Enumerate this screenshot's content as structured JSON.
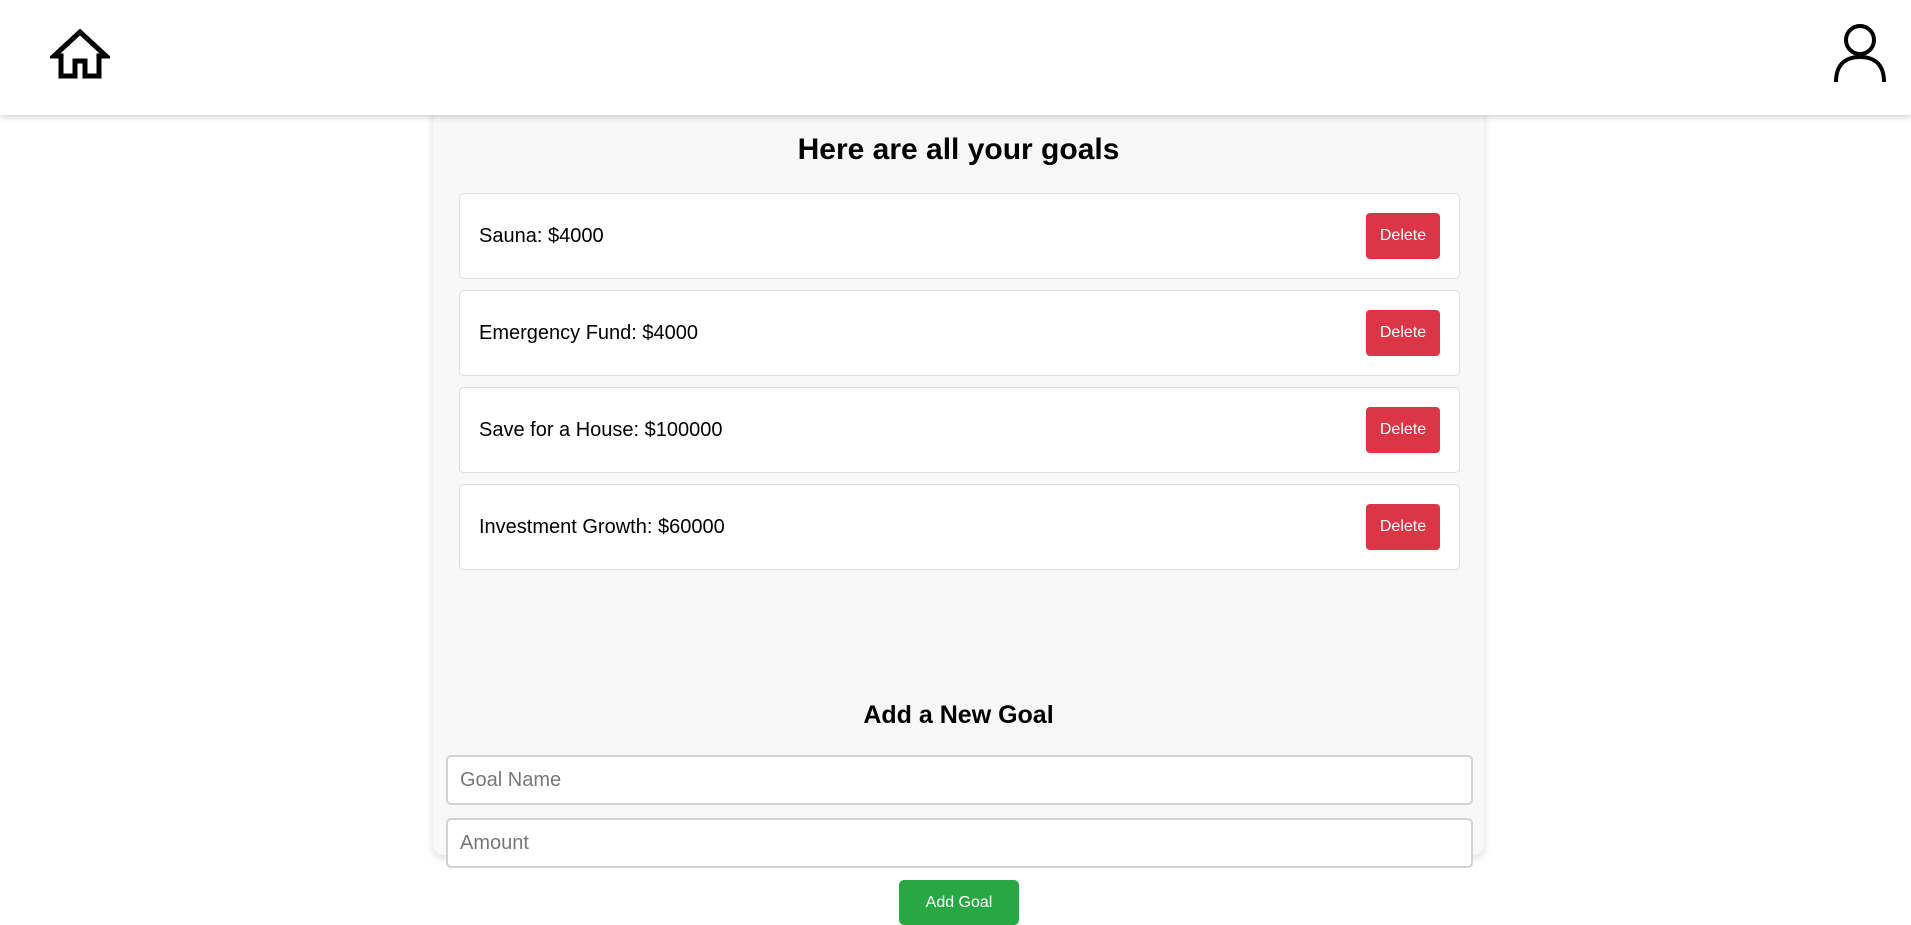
{
  "header": {
    "home_icon": "home-icon",
    "profile_icon": "user-profile-icon"
  },
  "goals_section": {
    "title": "Here are all your goals",
    "goals": [
      {
        "text": "Sauna: $4000",
        "delete_label": "Delete"
      },
      {
        "text": "Emergency Fund: $4000",
        "delete_label": "Delete"
      },
      {
        "text": "Save for a House: $100000",
        "delete_label": "Delete"
      },
      {
        "text": "Investment Growth: $60000",
        "delete_label": "Delete"
      }
    ]
  },
  "add_goal": {
    "title": "Add a New Goal",
    "goal_name_placeholder": "Goal Name",
    "goal_name_value": "",
    "amount_placeholder": "Amount",
    "amount_value": "",
    "submit_label": "Add Goal"
  },
  "colors": {
    "delete": "#dc3545",
    "add": "#28a745",
    "card_bg": "#f8f8f8"
  }
}
